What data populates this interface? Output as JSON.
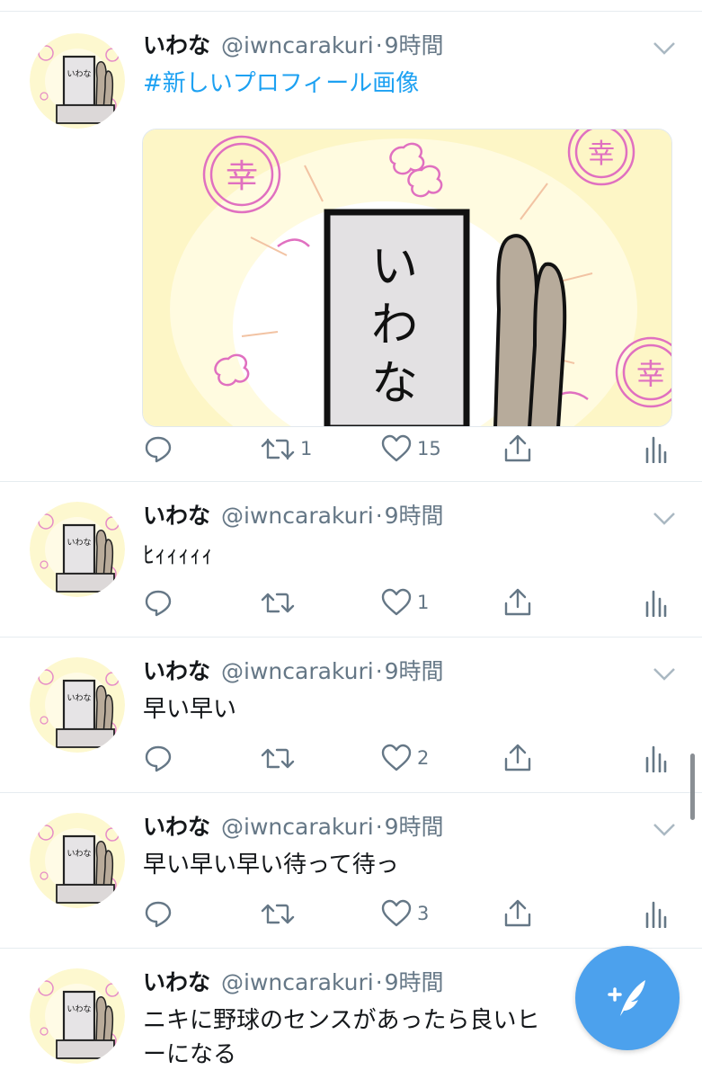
{
  "tweets": [
    {
      "name": "いわな",
      "handle": "@iwncarakuri",
      "time": "9時間",
      "text": "#新しいプロフィール画像",
      "is_hashtag": true,
      "media_text": [
        "い",
        "わ",
        "な"
      ],
      "media_stamp": "幸",
      "replies": "",
      "retweets": "1",
      "likes": "15"
    },
    {
      "name": "いわな",
      "handle": "@iwncarakuri",
      "time": "9時間",
      "text": "ﾋｨｨｨｨｨ",
      "replies": "",
      "retweets": "",
      "likes": "1"
    },
    {
      "name": "いわな",
      "handle": "@iwncarakuri",
      "time": "9時間",
      "text": "早い早い",
      "replies": "",
      "retweets": "",
      "likes": "2"
    },
    {
      "name": "いわな",
      "handle": "@iwncarakuri",
      "time": "9時間",
      "text": "早い早い早い待って待っ",
      "replies": "",
      "retweets": "",
      "likes": "3"
    },
    {
      "name": "いわな",
      "handle": "@iwncarakuri",
      "time": "9時間",
      "text_line1": "ニキに野球のセンスがあったら良いヒ",
      "text_line2": "ーになる"
    }
  ],
  "avatar_text": "いわな",
  "time_separator": "·",
  "icons": {
    "reply": "reply-icon",
    "retweet": "retweet-icon",
    "like": "heart-icon",
    "share": "share-icon",
    "analytics": "analytics-icon",
    "caret": "chevron-down-icon",
    "compose": "compose-tweet-icon"
  },
  "colors": {
    "link": "#1da1f2",
    "secondary_text": "#657786",
    "fab": "#4ca1ed",
    "divider": "#e6ecf0"
  }
}
